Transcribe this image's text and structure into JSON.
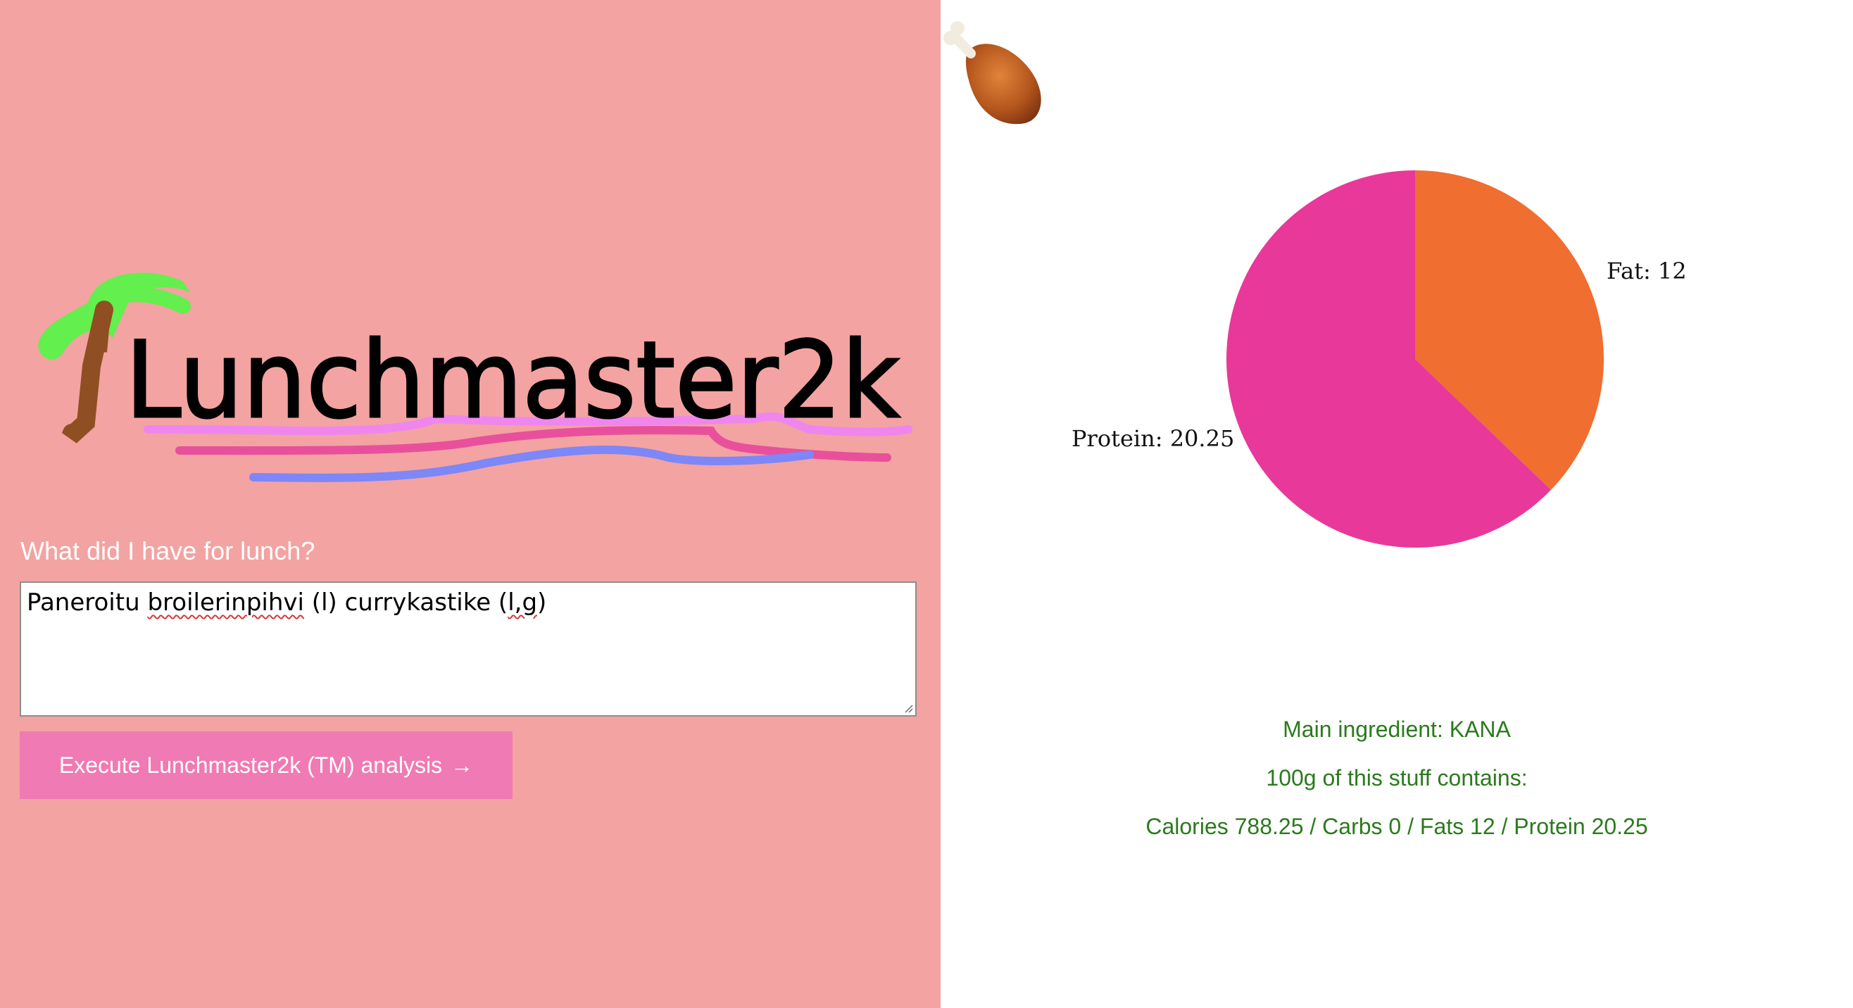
{
  "logo": {
    "text": "Lunchmaster2k"
  },
  "form": {
    "label": "What did I have for lunch?",
    "input_value_parts": [
      "Paneroitu ",
      "broilerinpihvi",
      " (l) currykastike (",
      "l,g",
      ")"
    ],
    "button_label": "Execute Lunchmaster2k (TM) analysis",
    "button_arrow": "→"
  },
  "chart_data": {
    "type": "pie",
    "slices": [
      {
        "name": "Fat",
        "value": 12,
        "color": "#ef6e30",
        "label": "Fat: 12"
      },
      {
        "name": "Protein",
        "value": 20.25,
        "color": "#e8389a",
        "label": "Protein: 20.25"
      }
    ]
  },
  "result": {
    "main_ingredient": "Main ingredient: KANA",
    "contains_heading": "100g of this stuff contains:",
    "nutrition_line": "Calories 788.25 / Carbs 0 / Fats 12 / Protein 20.25"
  },
  "icons": {
    "food_icon": "drumstick-icon",
    "logo_decoration": "palm-tree-icon"
  },
  "colors": {
    "left_panel_bg": "#f3a3a2",
    "button_bg": "#f07ab3",
    "result_text": "#2b7a1c"
  }
}
